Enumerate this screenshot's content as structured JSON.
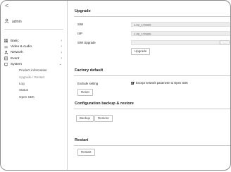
{
  "nav": {
    "back_glyph": "<"
  },
  "user": {
    "name": "admin",
    "icon": "user-icon"
  },
  "menu": [
    {
      "label": "Basic",
      "icon": "grid-icon"
    },
    {
      "label": "Video & Audio",
      "icon": "lines-icon"
    },
    {
      "label": "Network",
      "icon": "network-icon"
    },
    {
      "label": "Event",
      "icon": "calendar-icon"
    },
    {
      "label": "System",
      "icon": "monitor-icon"
    }
  ],
  "system_submenu": [
    {
      "label": "Product information"
    },
    {
      "label": "Upgrade / Restart",
      "active": true
    },
    {
      "label": "Log"
    },
    {
      "label": "Status"
    },
    {
      "label": "Open SDK"
    }
  ],
  "upgrade": {
    "title": "Upgrade",
    "sw_label": "S/W",
    "sw_value": "1.02_170809",
    "isp_label": "ISP",
    "isp_value": "1.05_170809",
    "sw_upgrade_label": "S/W Upgrade",
    "sw_upgrade_value": "",
    "browse_glyph": "...",
    "upgrade_button": "Upgrade"
  },
  "factory_default": {
    "title": "Factory default",
    "exclude_label": "Exclude setting",
    "exclude_option": "Except network parameter & Open SDK",
    "exclude_checked": true,
    "reset_button": "Reset"
  },
  "config": {
    "title": "Configuration backup & restore",
    "backup_button": "Backup",
    "restore_button": "Restore"
  },
  "restart": {
    "title": "Restart",
    "restart_button": "Restart"
  },
  "colors": {
    "accent": "#222222",
    "border": "#8a8a8a",
    "field_bg": "#ececec"
  }
}
